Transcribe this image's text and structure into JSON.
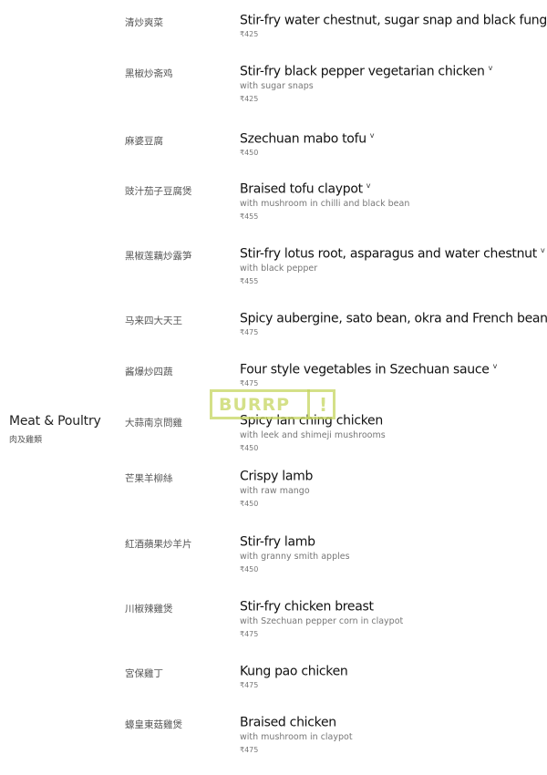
{
  "section": {
    "title": "Meat & Poultry",
    "subtitle": "肉及雞類"
  },
  "watermark": {
    "text": "BURRP",
    "mark": "!"
  },
  "items": [
    {
      "cn": "清炒爽菜",
      "en": "Stir-fry water chestnut, sugar snap and black fungus",
      "veg": "v",
      "desc": "",
      "price": "₹425"
    },
    {
      "cn": "黑椒炒斋鸡",
      "en": "Stir-fry black pepper vegetarian chicken",
      "veg": "v",
      "desc": "with sugar snaps",
      "price": "₹425"
    },
    {
      "cn": "麻婆豆腐",
      "en": "Szechuan mabo tofu",
      "veg": "v",
      "desc": "",
      "price": "₹450"
    },
    {
      "cn": "豉汁茄子豆腐煲",
      "en": "Braised tofu claypot",
      "veg": "v",
      "desc": "with mushroom in chilli and black bean",
      "price": "₹455"
    },
    {
      "cn": "黑椒莲藕炒露笋",
      "en": "Stir-fry lotus root, asparagus and water chestnut",
      "veg": "v",
      "desc": "with black pepper",
      "price": "₹455"
    },
    {
      "cn": "马来四大天王",
      "en": "Spicy aubergine, sato bean, okra and French bean",
      "veg": "v",
      "desc": "",
      "price": "₹475"
    },
    {
      "cn": "酱爆炒四蔬",
      "en": "Four style vegetables in Szechuan sauce",
      "veg": "v",
      "desc": "",
      "price": "₹475"
    },
    {
      "cn": "大蒜南京問雞",
      "en": "Spicy lan ching chicken",
      "veg": "",
      "desc": "with leek and shimeji mushrooms",
      "price": "₹450"
    },
    {
      "cn": "芒果羊柳絲",
      "en": "Crispy lamb",
      "veg": "",
      "desc": "with raw mango",
      "price": "₹450"
    },
    {
      "cn": "紅酒蘋果炒羊片",
      "en": "Stir-fry lamb",
      "veg": "",
      "desc": "with granny smith apples",
      "price": "₹450"
    },
    {
      "cn": "川椒辣雞煲",
      "en": "Stir-fry chicken breast",
      "veg": "",
      "desc": "with Szechuan pepper corn in claypot",
      "price": "₹475"
    },
    {
      "cn": "宮保雞丁",
      "en": "Kung pao chicken",
      "veg": "",
      "desc": "",
      "price": "₹475"
    },
    {
      "cn": "蠔皇東菇雞煲",
      "en": "Braised chicken",
      "veg": "",
      "desc": "with mushroom in claypot",
      "price": "₹475"
    }
  ]
}
